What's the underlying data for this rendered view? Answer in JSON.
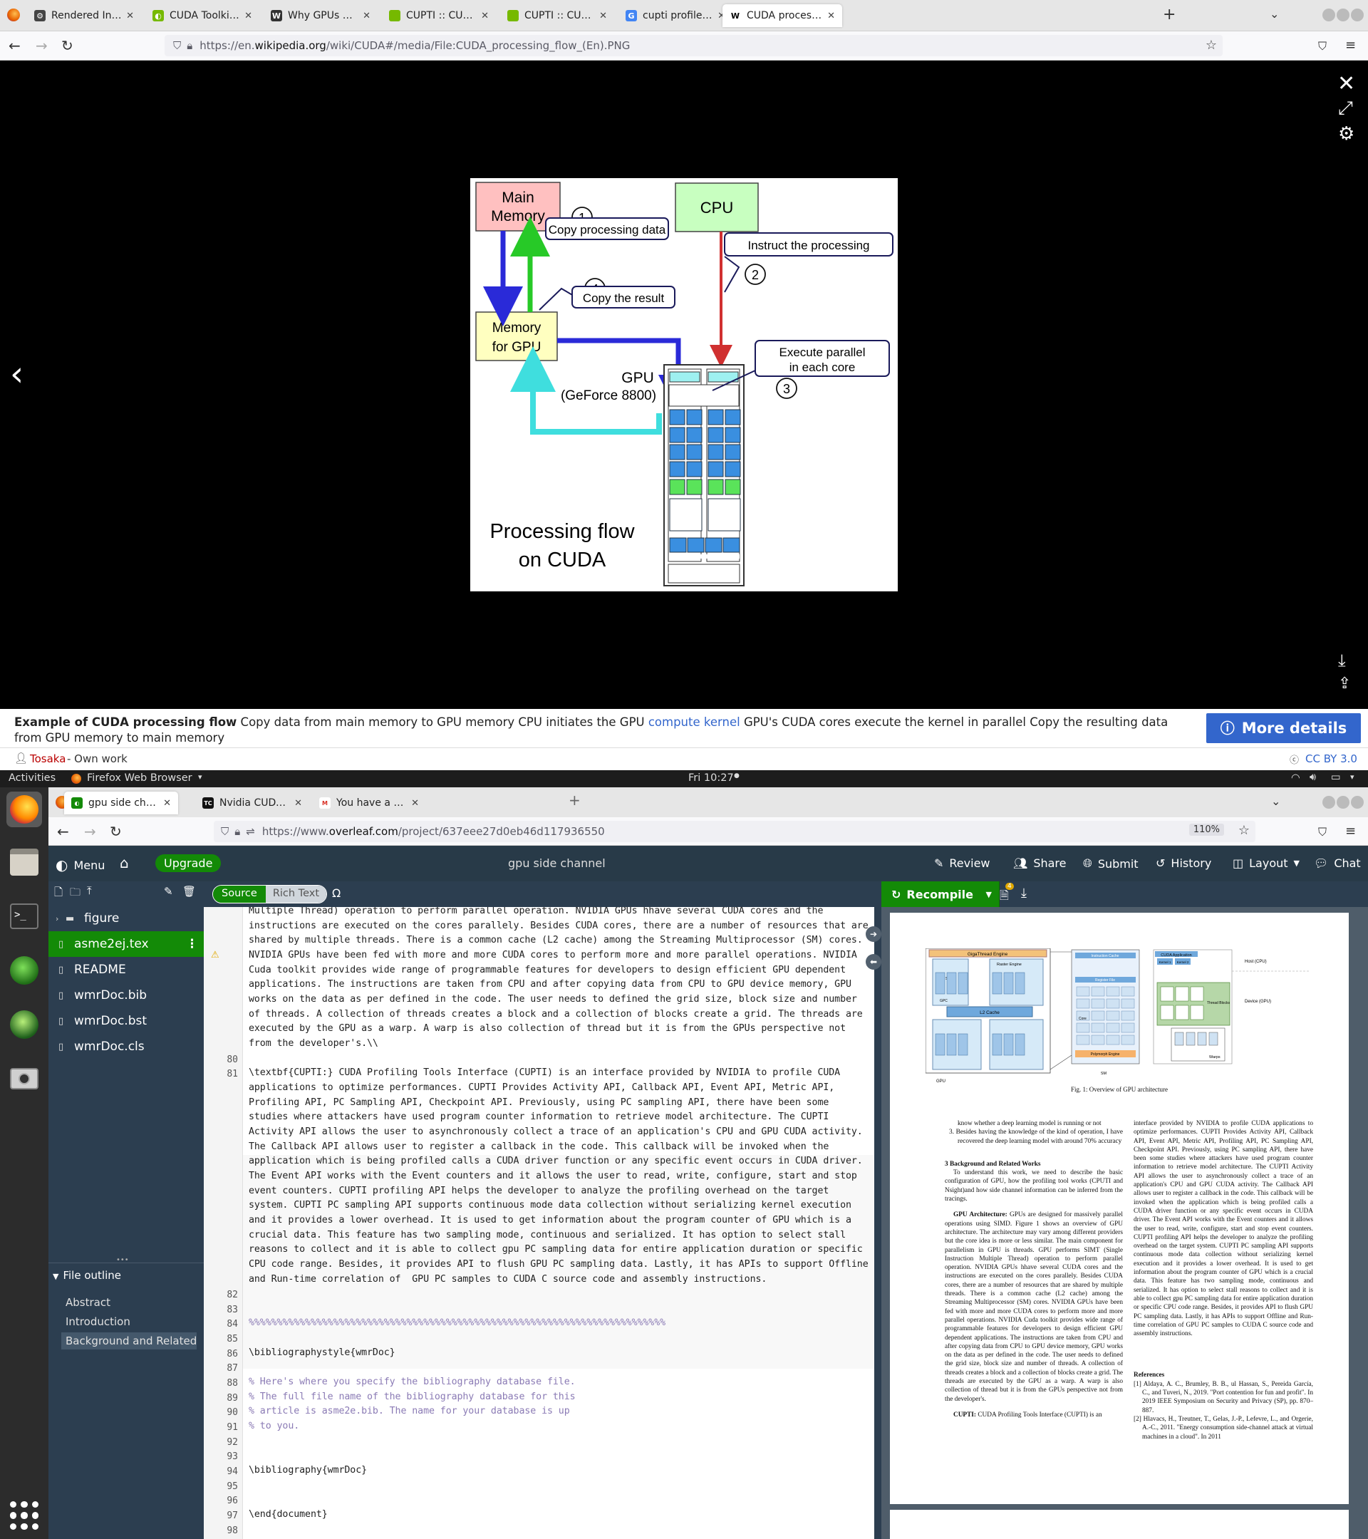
{
  "browser_top": {
    "tabs": [
      {
        "title": "Rendered Insecure: GPU",
        "active": false
      },
      {
        "title": "CUDA Toolkit - Free Tool",
        "active": false
      },
      {
        "title": "Why GPUs are more suite",
        "active": false
      },
      {
        "title": "CUPTI :: CUDA Toolkit Docum",
        "active": false
      },
      {
        "title": "CUPTI :: CUPTI Documentati",
        "active": false
      },
      {
        "title": "cupti profiler - Google Se",
        "active": false
      },
      {
        "title": "CUDA processing flow (E",
        "active": true
      }
    ],
    "url_prefix": "https://en.",
    "url_domain": "wikipedia.org",
    "url_path": "/wiki/CUDA#/media/File:CUDA_processing_flow_(En).PNG"
  },
  "diagram": {
    "main_memory": "Main\nMemory",
    "main_memory_l1": "Main",
    "main_memory_l2": "Memory",
    "cpu": "CPU",
    "gpu_memory_l1": "Memory",
    "gpu_memory_l2": "for GPU",
    "gpu_l1": "GPU",
    "gpu_l2": "(GeForce 8800)",
    "step1": "1",
    "step2": "2",
    "step3": "3",
    "step4": "4",
    "label1": "Copy processing data",
    "label2": "Instruct the processing",
    "label3_l1": "Execute parallel",
    "label3_l2": "in each core",
    "label4": "Copy the result",
    "caption_l1": "Processing flow",
    "caption_l2": "on CUDA"
  },
  "media_caption": {
    "title": "Example of CUDA processing flow",
    "text1": "Copy data from main memory to GPU memory CPU initiates the GPU",
    "link": "compute kernel",
    "text2": "GPU's CUDA cores execute the kernel in parallel Copy the resulting data from GPU memory to main memory",
    "more_details": "More details",
    "author": "Tosaka",
    "author_suffix": "- Own work",
    "license": "CC BY 3.0"
  },
  "ubuntu": {
    "activities": "Activities",
    "app": "Firefox Web Browser",
    "clock": "Fri 10:27"
  },
  "browser_second": {
    "tabs": [
      {
        "title": "gpu side channel - Online",
        "active": true
      },
      {
        "title": "Nvidia CUDA Cores Expla",
        "active": false
      },
      {
        "title": "You have a new statemen",
        "active": false
      }
    ],
    "url_prefix": "https://www.",
    "url_domain": "overleaf.com",
    "url_path": "/project/637eee27d0eb46d117936550",
    "zoom": "110%"
  },
  "overleaf": {
    "menu": "Menu",
    "upgrade": "Upgrade",
    "project_title": "gpu side channel",
    "review": "Review",
    "share": "Share",
    "submit": "Submit",
    "history": "History",
    "layout": "Layout",
    "chat": "Chat",
    "source_tab": "Source",
    "rich_text_tab": "Rich Text",
    "omega": "Ω",
    "recompile": "Recompile",
    "log_badge": "4",
    "files": [
      "figure",
      "asme2ej.tex",
      "README",
      "wmrDoc.bib",
      "wmrDoc.bst",
      "wmrDoc.cls"
    ],
    "outline_title": "File outline",
    "outline_items": [
      "Abstract",
      "Introduction",
      "Background and Related ..."
    ]
  },
  "editor": {
    "lines": [
      {
        "n": "",
        "t": "Multiple Thread) operation to perform parallel operation. NVIDIA GPUs hhave several CUDA cores and the"
      },
      {
        "n": "",
        "t": "instructions are executed on the cores parallely. Besides CUDA cores, there are a number of resources that are"
      },
      {
        "n": "",
        "t": "shared by multiple threads. There is a common cache (L2 cache) among the Streaming Multiprocessor (SM) cores."
      },
      {
        "n": "",
        "t": "NVIDIA GPUs have been fed with more and more CUDA cores to perform more and more parallel operations. NVIDIA"
      },
      {
        "n": "",
        "t": "Cuda toolkit provides wide range of programmable features for developers to design efficient GPU dependent"
      },
      {
        "n": "",
        "t": "applications. The instructions are taken from CPU and after copying data from CPU to GPU device memory, GPU"
      },
      {
        "n": "",
        "t": "works on the data as per defined in the code. The user needs to defined the grid size, block size and number"
      },
      {
        "n": "",
        "t": "of threads. A collection of threads creates a block and a collection of blocks create a grid. The threads are"
      },
      {
        "n": "",
        "t": "executed by the GPU as a warp. A warp is also collection of thread but it is from the GPUs perspective not"
      },
      {
        "n": "",
        "t": "from the developer's.\\\\"
      },
      {
        "n": "80",
        "t": ""
      },
      {
        "n": "81",
        "t": "\\textbf{CUPTI:} CUDA Profiling Tools Interface (CUPTI) is an interface provided by NVIDIA to profile CUDA"
      },
      {
        "n": "",
        "t": "applications to optimize performances. CUPTI Provides Activity API, Callback API, Event API, Metric API,"
      },
      {
        "n": "",
        "t": "Profiling API, PC Sampling API, Checkpoint API. Previously, using PC sampling API, there have been some"
      },
      {
        "n": "",
        "t": "studies where attackers have used program counter information to retrieve model architecture. The CUPTI"
      },
      {
        "n": "",
        "t": "Activity API allows the user to asynchronously collect a trace of an application's CPU and GPU CUDA activity."
      },
      {
        "n": "",
        "t": "The Callback API allows user to register a callback in the code. This callback will be invoked when the"
      },
      {
        "n": "",
        "t": "application which is being profiled calls a CUDA driver function or any specific event occurs in CUDA driver."
      },
      {
        "n": "",
        "t": "The Event API works with the Event counters and it allows the user to read, write, configure, start and stop"
      },
      {
        "n": "",
        "t": "event counters. CUPTI profiling API helps the developer to analyze the profiling overhead on the target"
      },
      {
        "n": "",
        "t": "system. CUPTI PC sampling API supports continuous mode data collection without serializing kernel execution"
      },
      {
        "n": "",
        "t": "and it provides a lower overhead. It is used to get information about the program counter of GPU which is a"
      },
      {
        "n": "",
        "t": "crucial data. This feature has two sampling mode, continuous and serialized. It has option to select stall"
      },
      {
        "n": "",
        "t": "reasons to collect and it is able to collect gpu PC sampling data for entire application duration or specific"
      },
      {
        "n": "",
        "t": "CPU code range. Besides, it provides API to flush GPU PC sampling data. Lastly, it has APIs to support Offline"
      },
      {
        "n": "",
        "t": "and Run-time correlation of  GPU PC samples to CUDA C source code and assembly instructions."
      },
      {
        "n": "82",
        "t": ""
      },
      {
        "n": "83",
        "t": ""
      },
      {
        "n": "84",
        "t": "%%%%%%%%%%%%%%%%%%%%%%%%%%%%%%%%%%%%%%%%%%%%%%%%%%%%%%%%%%%%%%%%%%%%%%%%%%"
      },
      {
        "n": "85",
        "t": ""
      },
      {
        "n": "86",
        "t": "\\bibliographystyle{wmrDoc}"
      },
      {
        "n": "87",
        "t": ""
      },
      {
        "n": "88",
        "t": "% Here's where you specify the bibliography database file."
      },
      {
        "n": "89",
        "t": "% The full file name of the bibliography database for this"
      },
      {
        "n": "90",
        "t": "% article is asme2e.bib. The name for your database is up"
      },
      {
        "n": "91",
        "t": "% to you."
      },
      {
        "n": "92",
        "t": ""
      },
      {
        "n": "93",
        "t": ""
      },
      {
        "n": "94",
        "t": "\\bibliography{wmrDoc}"
      },
      {
        "n": "95",
        "t": ""
      },
      {
        "n": "96",
        "t": ""
      },
      {
        "n": "97",
        "t": "\\end{document}"
      },
      {
        "n": "98",
        "t": ""
      }
    ]
  },
  "pdf": {
    "fig_caption": "Fig. 1: Overview of GPU architecture",
    "fig_gigathread": "GigaThread Engine",
    "fig_raster": "Raster Engine",
    "fig_l2": "L2 Cache",
    "fig_sm": "SM",
    "fig_gpu": "GPU",
    "fig_gpc": "GPC",
    "fig_instr_cache": "Instruction Cache",
    "fig_register": "Register File",
    "fig_core": "Core",
    "fig_polymorph": "Polymorph Engine",
    "fig_cuda_app": "CUDA Application",
    "fig_kernel1": "Kernel 1",
    "fig_kernel2": "Kernel 2",
    "fig_host": "Host (CPU)",
    "fig_device": "Device (GPU)",
    "fig_thread_blocks": "Thread\nBlocks",
    "fig_warps": "Warps",
    "left_col": [
      "know whether a deep learning model is running or not",
      "3. Besides having the knowledge of the kind of operation, I have recovered the deep learning model with around 70% accuracy"
    ],
    "section_title": "3   Background and Related Works",
    "section_body": "To understand this work, we need to describe the basic configuration of GPU, how the profiling tool works (CPUTI and Nsight)and how side channel information can be inferred from the tracings.",
    "gpu_arch_head": "GPU Architecture:",
    "gpu_arch_body": "GPUs are designed for massively parallel operations using SIMD. Figure 1 shows an overview of GPU architecture. The architecture may vary among different providers but the core idea is more or less similar. The main component for parallelism in GPU is threads. GPU performs SIMT (Single Instruction Multiple Thread) operation to perform parallel operation. NVIDIA GPUs hhave several CUDA cores and the instructions are executed on the cores parallely. Besides CUDA cores, there are a number of resources that are shared by multiple threads. There is a common cache (L2 cache) among the Streaming Multiprocessor (SM) cores. NVIDIA GPUs have been fed with more and more CUDA cores to perform more and more parallel operations. NVIDIA Cuda toolkit provides wide range of programmable features for developers to design efficient GPU dependent applications. The instructions are taken from CPU and after copying data from CPU to GPU device memory, GPU works on the data as per defined in the code. The user needs to defined the grid size, block size and number of threads. A collection of threads creates a block and a collection of blocks create a grid. The threads are executed by the GPU as a warp. A warp is also collection of thread but it is from the GPUs perspective not from the developer's.",
    "cupti_head": "CUPTI:",
    "cupti_body": "CUDA Profiling Tools Interface (CUPTI) is an",
    "right_col": "interface provided by NVIDIA to profile CUDA applications to optimize performances. CUPTI Provides Activity API, Callback API, Event API, Metric API, Profiling API, PC Sampling API, Checkpoint API. Previously, using PC sampling API, there have been some studies where attackers have used program counter information to retrieve model architecture. The CUPTI Activity API allows the user to asynchronously collect a trace of an application's CPU and GPU CUDA activity. The Callback API allows user to register a callback in the code. This callback will be invoked when the application which is being profiled calls a CUDA driver function or any specific event occurs in CUDA driver. The Event API works with the Event counters and it allows the user to read, write, configure, start and stop event counters. CUPTI profiling API helps the developer to analyze the profiling overhead on the target system. CUPTI PC sampling API supports continuous mode data collection without serializing kernel execution and it provides a lower overhead. It is used to get information about the program counter of GPU which is a crucial data. This feature has two sampling mode, continuous and serialized. It has option to select stall reasons to collect and it is able to collect gpu PC sampling data for entire application duration or specific CPU code range. Besides, it provides API to flush GPU PC sampling data. Lastly, it has APIs to support Offline and Run-time correlation of GPU PC samples to CUDA C source code and assembly instructions.",
    "references_title": "References",
    "ref1": "[1] Aldaya, A. C., Brumley, B. B., ul Hassan, S., Pereida García, C., and Tuveri, N., 2019. \"Port contention for fun and profit\". In 2019 IEEE Symposium on Security and Privacy (SP), pp. 870–887.",
    "ref2": "[2] Hlavacs, H., Treutner, T., Gelas, J.-P., Lefevre, L., and Orgerie, A.-C., 2011. \"Energy consumption side-channel attack at virtual machines in a cloud\". In 2011"
  },
  "colors": {
    "overleaf_header": "#283a48",
    "overleaf_green": "#138a07",
    "wiki_blue": "#3366cc",
    "file_tree": "#2c3e50"
  }
}
